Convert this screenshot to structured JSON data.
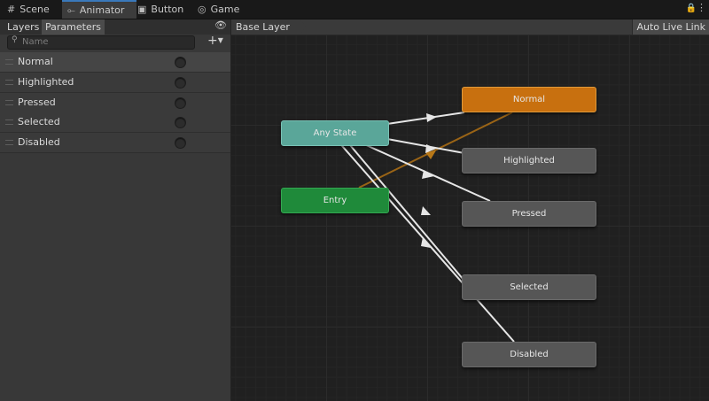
{
  "window_tabs": [
    {
      "label": "Scene",
      "icon": "grid-icon"
    },
    {
      "label": "Animator",
      "icon": "animator-icon"
    },
    {
      "label": "Button",
      "icon": "script-icon"
    },
    {
      "label": "Game",
      "icon": "gamepad-icon"
    }
  ],
  "left_panel": {
    "tabs": [
      "Layers",
      "Parameters"
    ],
    "search_placeholder": "Name",
    "add_label": "+",
    "parameters": [
      {
        "name": "Normal"
      },
      {
        "name": "Highlighted"
      },
      {
        "name": "Pressed"
      },
      {
        "name": "Selected"
      },
      {
        "name": "Disabled"
      }
    ]
  },
  "graph": {
    "breadcrumb": "Base Layer",
    "auto_live_link": "Auto Live Link",
    "states": {
      "any_state": "Any State",
      "entry": "Entry",
      "normal": "Normal",
      "highlighted": "Highlighted",
      "pressed": "Pressed",
      "selected": "Selected",
      "disabled": "Disabled"
    }
  },
  "colors": {
    "default_state": "#c8700f",
    "any_state": "#5aa699",
    "entry": "#1f8a3a",
    "state": "#565656",
    "active_tab_accent": "#3a79bb"
  }
}
